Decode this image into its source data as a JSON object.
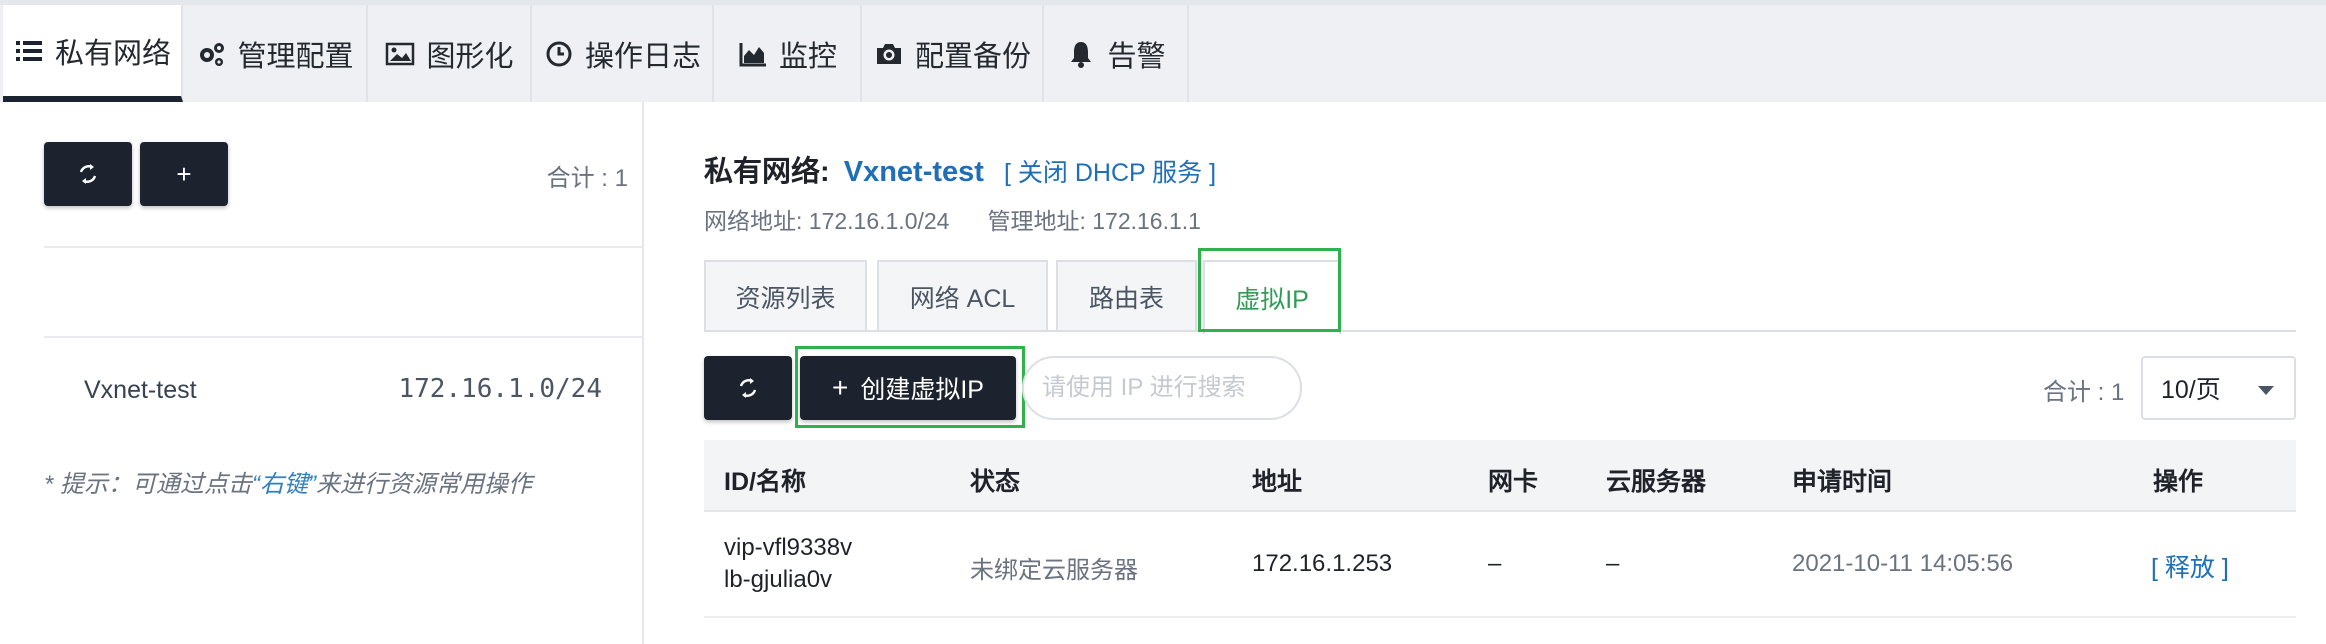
{
  "top_tabs": [
    {
      "label": "私有网络",
      "icon": "list-icon",
      "active": true
    },
    {
      "label": "管理配置",
      "icon": "gears-icon",
      "active": false
    },
    {
      "label": "图形化",
      "icon": "image-icon",
      "active": false
    },
    {
      "label": "操作日志",
      "icon": "clock-icon",
      "active": false
    },
    {
      "label": "监控",
      "icon": "area-chart-icon",
      "active": false
    },
    {
      "label": "配置备份",
      "icon": "camera-icon",
      "active": false
    },
    {
      "label": "告警",
      "icon": "bell-icon",
      "active": false
    }
  ],
  "left_panel": {
    "refresh_icon": "refresh-icon",
    "add_label": "+",
    "total": "合计 : 1",
    "network": {
      "name": "Vxnet-test",
      "cidr": "172.16.1.0/24"
    },
    "hint_prefix": "* 提示：可通过点击",
    "hint_keyword": "“右键”",
    "hint_suffix": "来进行资源常用操作"
  },
  "detail": {
    "title_label": "私有网络:",
    "name": "Vxnet-test",
    "dhcp_action": "[ 关闭 DHCP 服务 ]",
    "network_address": "网络地址: 172.16.1.0/24",
    "manage_address": "管理地址: 172.16.1.1",
    "tabs": [
      {
        "label": "资源列表",
        "active": false
      },
      {
        "label": "网络 ACL",
        "active": false
      },
      {
        "label": "路由表",
        "active": false
      },
      {
        "label": "虚拟IP",
        "active": true
      }
    ]
  },
  "toolbar": {
    "create_label": "创建虚拟IP",
    "create_plus": "+",
    "search_placeholder": "请使用 IP 进行搜索",
    "total": "合计 : 1",
    "page_size": "10/页"
  },
  "table": {
    "headers": [
      "ID/名称",
      "状态",
      "地址",
      "网卡",
      "云服务器",
      "申请时间",
      "操作"
    ],
    "rows": [
      {
        "id": "vip-vfl9338v",
        "name": "lb-gjulia0v",
        "status": "未绑定云服务器",
        "address": "172.16.1.253",
        "nic": "–",
        "server": "–",
        "time": "2021-10-11 14:05:56",
        "action": "[ 释放 ]"
      }
    ]
  },
  "colors": {
    "dark_button": "#1c232e",
    "link_blue": "#1e6fb8",
    "active_tab_green": "#2f9c54",
    "highlight_green": "#2eb34c"
  }
}
